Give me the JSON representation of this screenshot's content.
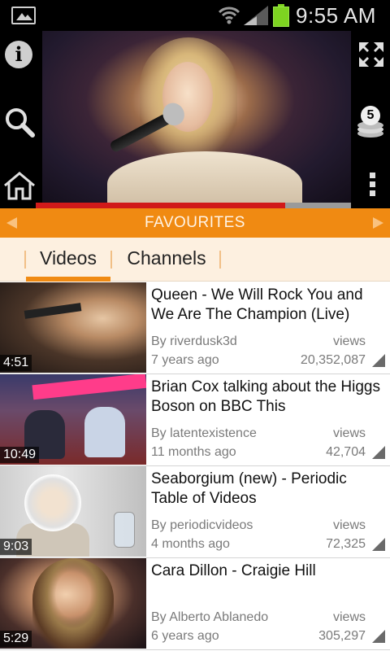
{
  "status_bar": {
    "time": "9:55 AM",
    "battery_color": "#7ed321"
  },
  "player": {
    "progress_fraction": 0.79,
    "progress_color": "#d01a1a",
    "stack_count": "5"
  },
  "section_header": {
    "title": "FAVOURITES",
    "accent_color": "#f08a12"
  },
  "tabs": [
    {
      "label": "Videos",
      "active": true
    },
    {
      "label": "Channels",
      "active": false
    }
  ],
  "videos": [
    {
      "title": "Queen - We Will Rock You and We Are The Champion (Live)",
      "author": "By riverdusk3d",
      "age": "7 years ago",
      "views_label": "views",
      "views": "20,352,087",
      "duration": "4:51"
    },
    {
      "title": "Brian Cox talking about the Higgs Boson on BBC This",
      "author": "By latentexistence",
      "age": "11 months ago",
      "views_label": "views",
      "views": "42,704",
      "duration": "10:49"
    },
    {
      "title": "Seaborgium (new) - Periodic Table of Videos",
      "author": "By periodicvideos",
      "age": "4 months ago",
      "views_label": "views",
      "views": "72,325",
      "duration": "9:03"
    },
    {
      "title": "Cara Dillon - Craigie Hill",
      "author": "By Alberto Ablanedo",
      "age": "6 years ago",
      "views_label": "views",
      "views": "305,297",
      "duration": "5:29"
    }
  ],
  "icons": {
    "status_left": "image-notification-icon",
    "wifi": "wifi-icon",
    "signal": "signal-icon",
    "battery": "battery-icon",
    "info": "info-icon",
    "search": "search-icon",
    "home": "home-icon",
    "expand": "fullscreen-icon",
    "stack": "coin-stack-icon",
    "more": "overflow-menu-icon"
  }
}
